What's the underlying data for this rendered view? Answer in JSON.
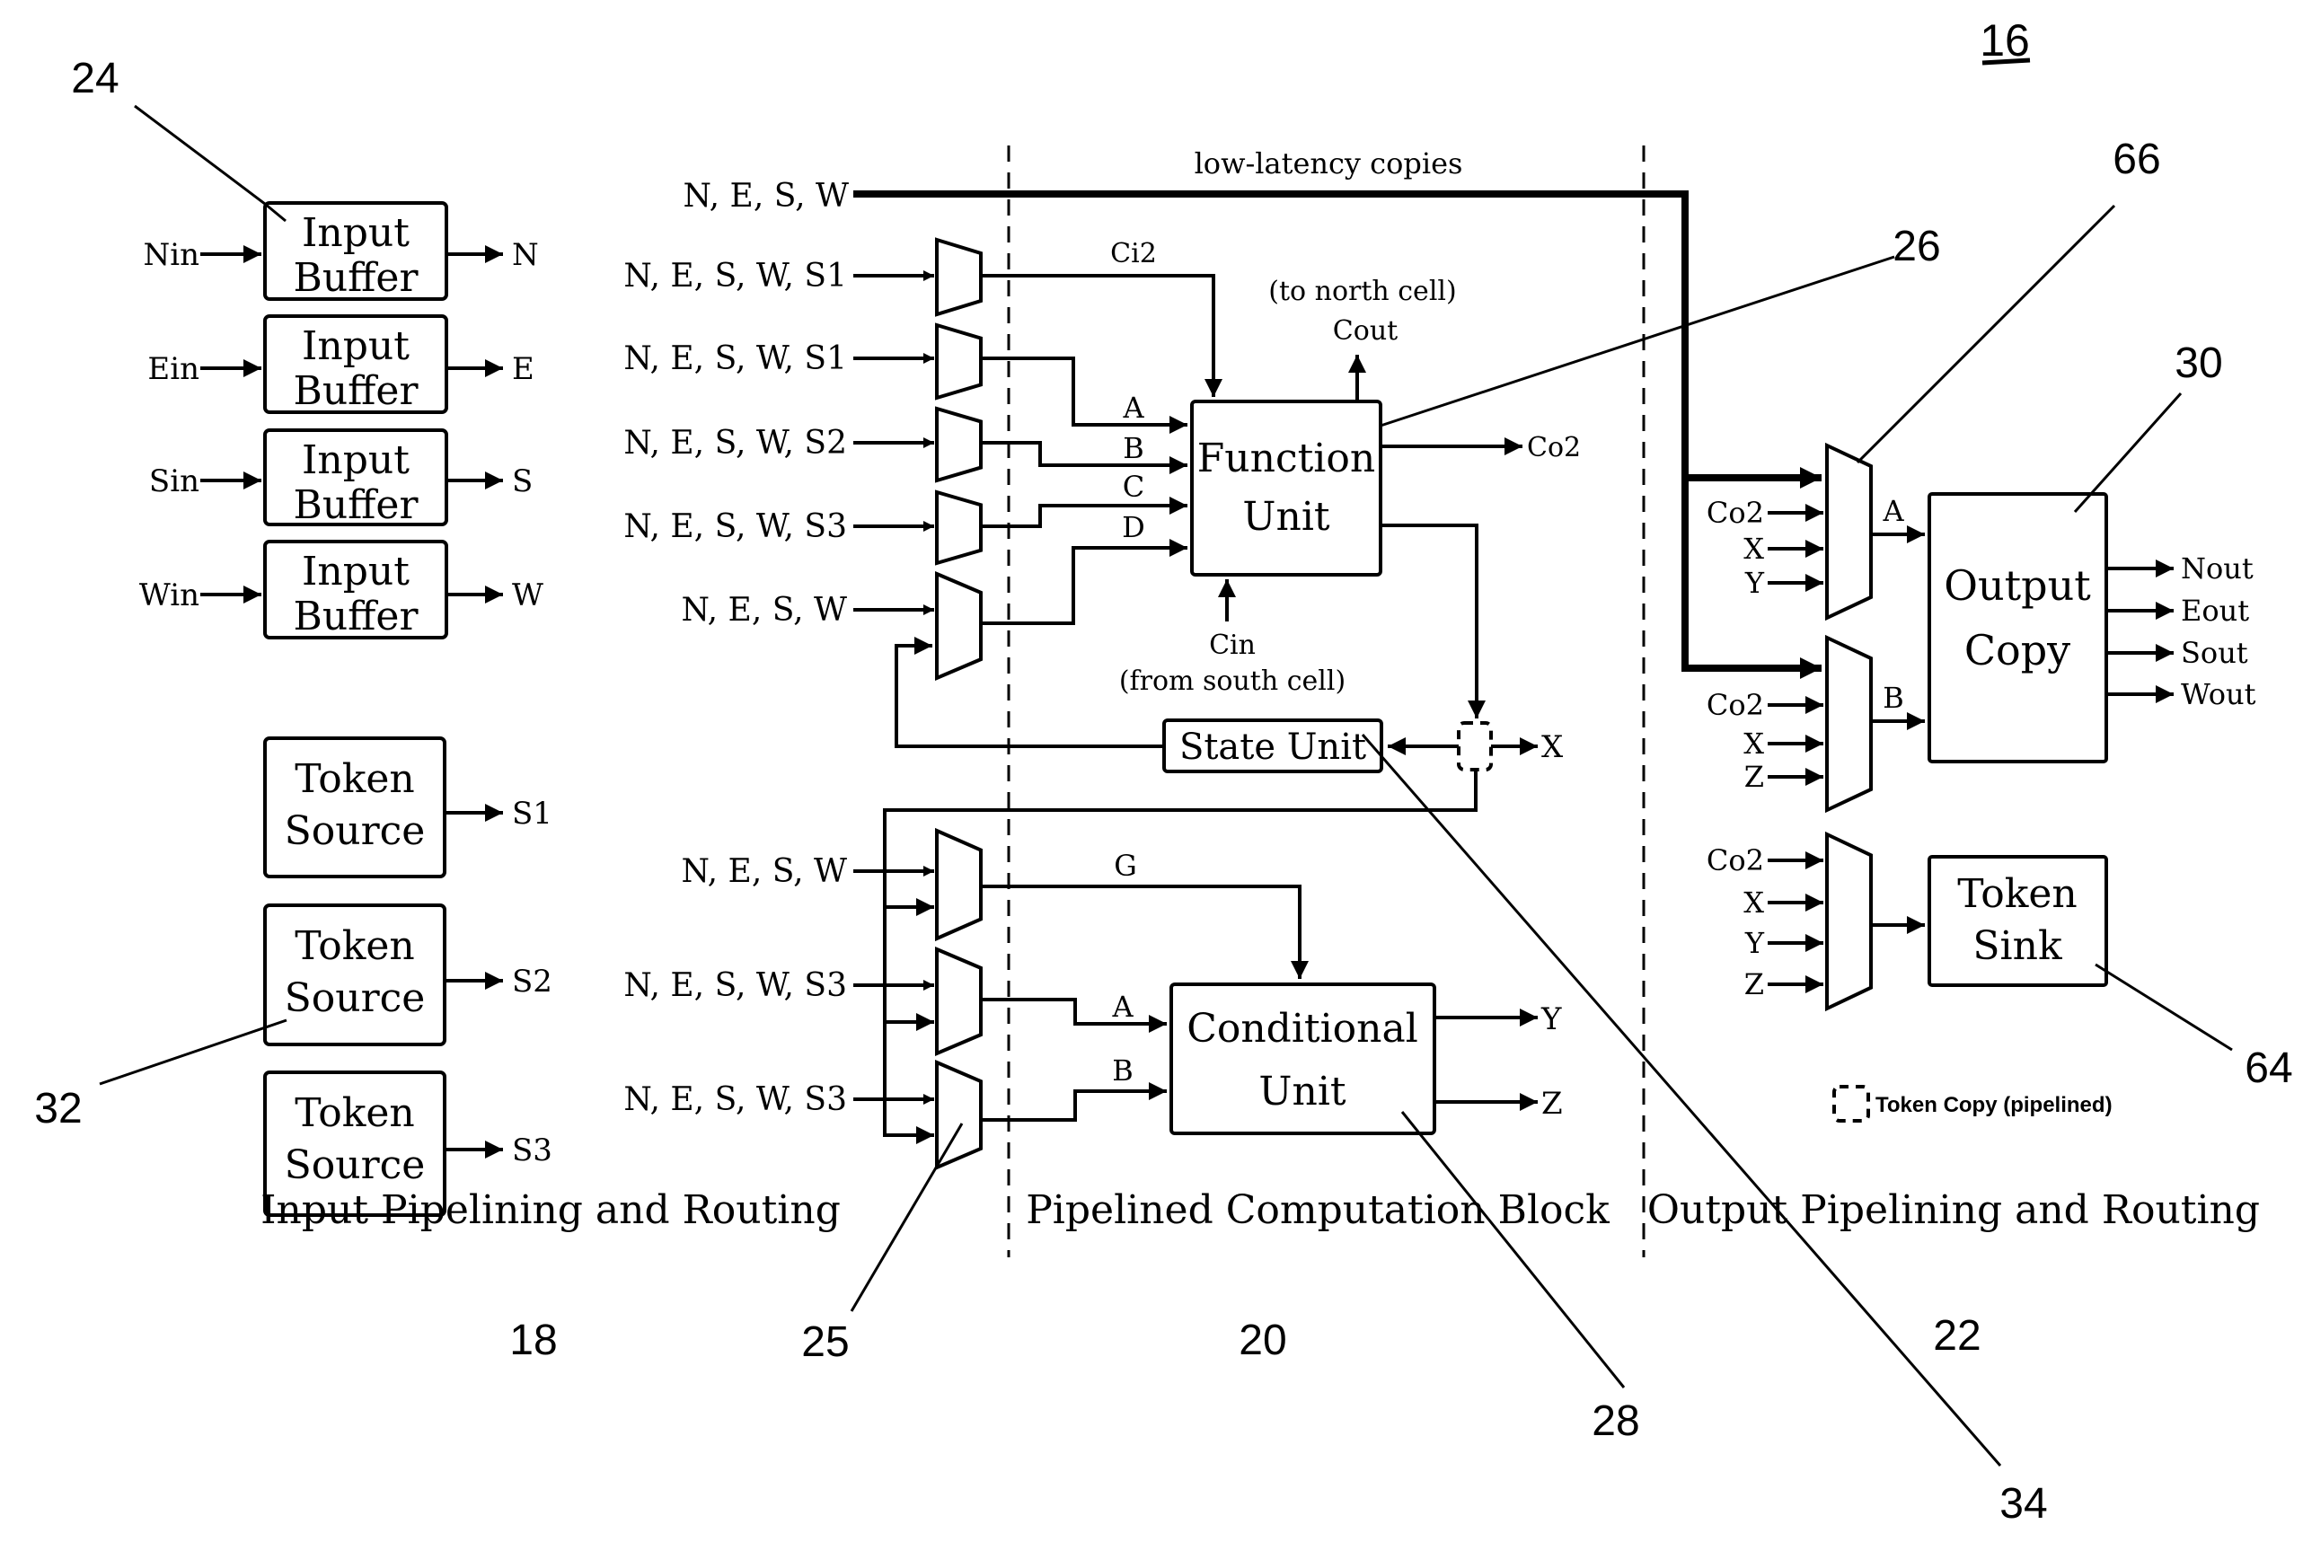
{
  "figure": {
    "figure_number": "16",
    "regions": [
      {
        "id": "input",
        "caption": "Input Pipelining and Routing",
        "ref": "18"
      },
      {
        "id": "compute",
        "caption": "Pipelined Computation Block",
        "ref": "20"
      },
      {
        "id": "output",
        "caption": "Output Pipelining and Routing",
        "ref": "22"
      }
    ],
    "input_buffers": [
      {
        "label_line1": "Input",
        "label_line2": "Buffer",
        "in": "Nin",
        "out": "N"
      },
      {
        "label_line1": "Input",
        "label_line2": "Buffer",
        "in": "Ein",
        "out": "E"
      },
      {
        "label_line1": "Input",
        "label_line2": "Buffer",
        "in": "Sin",
        "out": "S"
      },
      {
        "label_line1": "Input",
        "label_line2": "Buffer",
        "in": "Win",
        "out": "W"
      }
    ],
    "token_sources": [
      {
        "label_line1": "Token",
        "label_line2": "Source",
        "out": "S1"
      },
      {
        "label_line1": "Token",
        "label_line2": "Source",
        "out": "S2"
      },
      {
        "label_line1": "Token",
        "label_line2": "Source",
        "out": "S3"
      }
    ],
    "bypass_bus": {
      "source_label": "N, E, S, W",
      "label": "low-latency copies"
    },
    "function_muxes": [
      {
        "inputs": "N, E, S, W, S1",
        "signal": "Ci2"
      },
      {
        "inputs": "N, E, S, W, S1",
        "signal": "A"
      },
      {
        "inputs": "N, E, S, W, S2",
        "signal": "B"
      },
      {
        "inputs": "N, E, S, W, S3",
        "signal": "C"
      },
      {
        "inputs": "N, E, S, W",
        "signal": "D"
      }
    ],
    "function_unit": {
      "label_line1": "Function",
      "label_line2": "Unit",
      "carry_out": "Cout",
      "carry_out_note": "(to north cell)",
      "carry_in": "Cin",
      "carry_in_note": "(from south cell)",
      "output": "Co2"
    },
    "state_unit": {
      "label": "State Unit",
      "output": "X"
    },
    "conditional_muxes": [
      {
        "inputs": "N, E, S, W",
        "signal": "G"
      },
      {
        "inputs": "N, E, S, W, S3",
        "signal": "A"
      },
      {
        "inputs": "N, E, S, W, S3",
        "signal": "B"
      }
    ],
    "conditional_unit": {
      "label_line1": "Conditional",
      "label_line2": "Unit",
      "outputs": [
        "Y",
        "Z"
      ]
    },
    "output_muxes": [
      {
        "signal": "A",
        "inputs": [
          "Co2",
          "X",
          "Y"
        ]
      },
      {
        "signal": "B",
        "inputs": [
          "Co2",
          "X",
          "Z"
        ]
      },
      {
        "signal": "",
        "inputs": [
          "Co2",
          "X",
          "Y",
          "Z"
        ]
      }
    ],
    "output_copy": {
      "label_line1": "Output",
      "label_line2": "Copy",
      "outputs": [
        "Nout",
        "Eout",
        "Sout",
        "Wout"
      ]
    },
    "token_sink": {
      "label_line1": "Token",
      "label_line2": "Sink"
    },
    "legend": {
      "token_copy": "Token Copy (pipelined)"
    },
    "reference_numerals": {
      "input_buffer": "24",
      "token_source": "32",
      "mux": "25",
      "function_unit": "26",
      "conditional_unit": "28",
      "state_unit": "34",
      "output_mux": "66",
      "output_copy": "30",
      "token_sink": "64"
    }
  }
}
